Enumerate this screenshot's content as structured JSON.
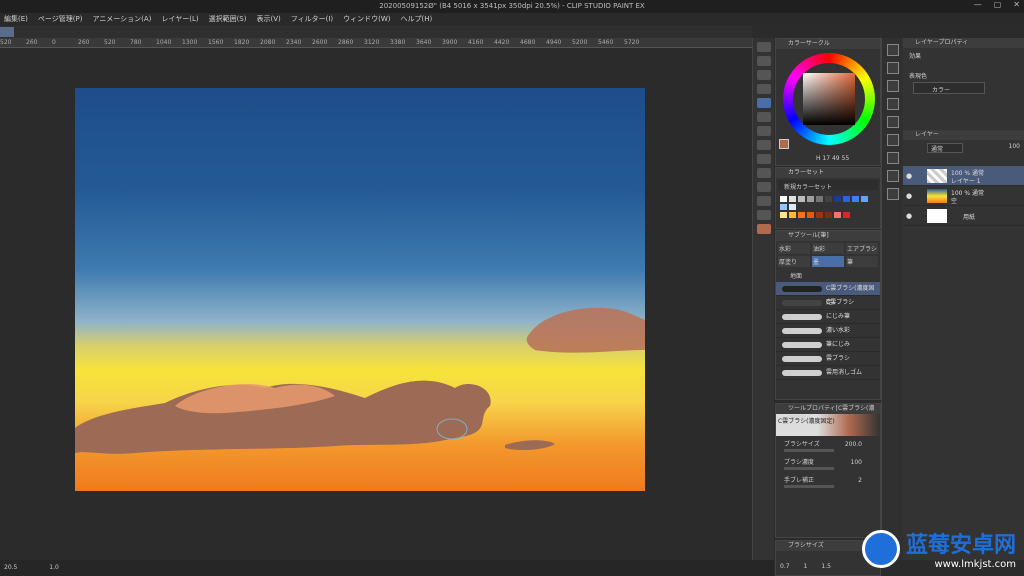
{
  "window": {
    "title": "20200509152Ø\" (B4 5016 x 3541px 350dpi 20.5%) - CLIP STUDIO PAINT EX",
    "controls": [
      "—",
      "▢",
      "✕"
    ]
  },
  "menu": [
    "編集(E)",
    "ページ管理(P)",
    "アニメーション(A)",
    "レイヤー(L)",
    "選択範囲(S)",
    "表示(V)",
    "フィルター(I)",
    "ウィンドウ(W)",
    "ヘルプ(H)"
  ],
  "ruler": [
    "520",
    "260",
    "0",
    "260",
    "520",
    "780",
    "1040",
    "1300",
    "1560",
    "1820",
    "2080",
    "2340",
    "2600",
    "2860",
    "3120",
    "3380",
    "3640",
    "3900",
    "4160",
    "4420",
    "4680",
    "4940",
    "5200",
    "5460",
    "5720"
  ],
  "color_panel": {
    "title": "カラーサークル",
    "readout": "H 17 49 55"
  },
  "color_set": {
    "title": "カラーセット",
    "set_name": "新規カラーセット",
    "swatches": [
      "#ffffff",
      "#e0e0e0",
      "#bdbdbd",
      "#9e9e9e",
      "#757575",
      "#424242",
      "#1e3a8a",
      "#2563eb",
      "#3b82f6",
      "#60a5fa",
      "#93c5fd",
      "#dbeafe",
      "#fde68a",
      "#fbbf24",
      "#f97316",
      "#ea580c",
      "#9a3412",
      "#7c2d12",
      "#f87171",
      "#dc2626"
    ]
  },
  "sub_tool": {
    "title": "サブツール[筆]",
    "tabs": [
      "水彩",
      "油彩",
      "エアブラシ",
      "厚塗り",
      "墨",
      "筆"
    ],
    "category": "地面",
    "brushes": [
      "C雲ブラシ(濃度固定)",
      "C雲ブラシ",
      "にじみ筆",
      "濃い水彩",
      "筆にじみ",
      "雲ブラシ",
      "雲用消しゴム"
    ]
  },
  "tool_property": {
    "title": "ツールプロパティ[C雲ブラシ(濃度固定)]",
    "preview_label": "C雲ブラシ(濃度固定)",
    "rows": [
      {
        "label": "ブラシサイズ",
        "value": "200.0"
      },
      {
        "label": "ブラシ濃度",
        "value": "100"
      },
      {
        "label": "手ブレ補正",
        "value": "2"
      }
    ]
  },
  "brush_size_panel": {
    "title": "ブラシサイズ",
    "values": [
      "0.7",
      "1",
      "1.5"
    ]
  },
  "layer_property": {
    "title": "レイヤープロパティ",
    "effect": "効果",
    "display_color_label": "表現色",
    "display_color_value": "カラー"
  },
  "layers": {
    "title": "レイヤー",
    "blend": "通常",
    "opacity": "100",
    "items": [
      {
        "meta": "100 % 通常",
        "name": "レイヤー 1"
      },
      {
        "meta": "100 % 通常",
        "name": "空"
      },
      {
        "meta": "",
        "name": "用紙"
      }
    ]
  },
  "status": {
    "zoom": "20.5",
    "angle": "1.0"
  },
  "watermark": {
    "name": "蓝莓安卓网",
    "url": "www.lmkjst.com"
  }
}
